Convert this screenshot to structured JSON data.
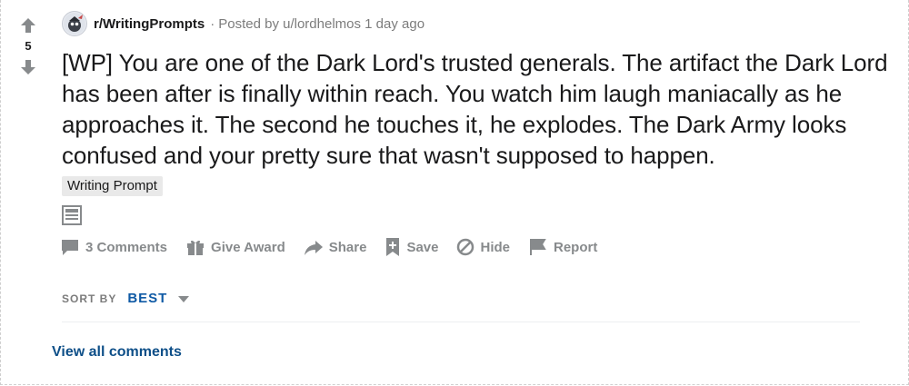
{
  "votes": {
    "count": "5"
  },
  "header": {
    "subreddit": "r/WritingPrompts",
    "separator": "·",
    "posted_by": "Posted by u/lordhelmos",
    "time": "1 day ago"
  },
  "post": {
    "title": "[WP] You are one of the Dark Lord's trusted generals. The artifact the Dark Lord has been after is finally within reach. You watch him laugh maniacally as he approaches it. The second he touches it, he explodes. The Dark Army looks confused and your pretty sure that wasn't supposed to happen.",
    "flair": "Writing Prompt"
  },
  "actions": {
    "comments": "3 Comments",
    "award": "Give Award",
    "share": "Share",
    "save": "Save",
    "hide": "Hide",
    "report": "Report"
  },
  "sort": {
    "label": "SORT BY",
    "value": "BEST"
  },
  "comments": {
    "view_all": "View all comments"
  },
  "colors": {
    "action_gray": "#878a8c",
    "link_blue": "#0f5aa5",
    "flair_bg": "#e9e9e9"
  }
}
